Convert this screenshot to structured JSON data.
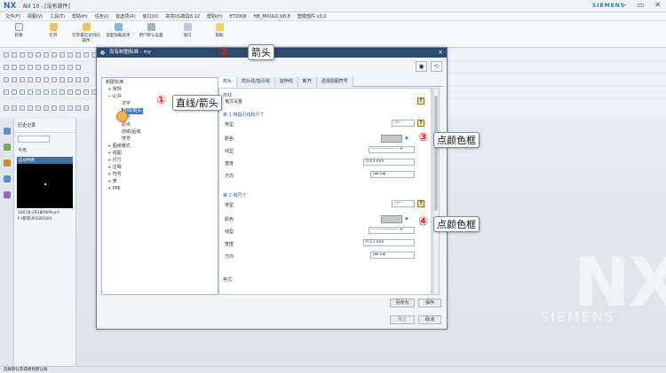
{
  "app": {
    "logo": "NX",
    "title": "NX 10 - [没有部件]",
    "brand": "SIEMENS",
    "window_buttons": [
      "–",
      "▭",
      "✕"
    ]
  },
  "menubar": [
    "文件(F)",
    "视图(V)",
    "工具(T)",
    "帮助(H)",
    "任务(I)",
    "首选项(R)",
    "窗口(O)",
    "高亮UG模具6.12",
    "帮助(H)",
    "ET2008",
    "HB_MOULD V8.8",
    "塑模部件 v3.0"
  ],
  "ribbon": [
    {
      "label": "新建",
      "icon": "new-icon"
    },
    {
      "label": "打开",
      "icon": "open-icon"
    },
    {
      "label": "打开最近访问的部件",
      "icon": "open-recent-icon"
    },
    {
      "label": "装配加载选项",
      "icon": "assembly-load-icon"
    },
    {
      "label": "用户默认设置",
      "icon": "user-defaults-icon"
    },
    {
      "label": "窗口",
      "icon": "window-icon"
    },
    {
      "label": "帮助",
      "icon": "help-icon"
    }
  ],
  "history": {
    "title": "历史记录",
    "today": "今天",
    "thumb_header": "自动判断",
    "file_line1": "18018-20180909.prt",
    "file_line2": "F:\\蔡欣\\X\\18018\\1"
  },
  "watermark": {
    "big": "NX",
    "small": "SIEMENS"
  },
  "status": "选择默认及或者找默认值",
  "dialog": {
    "title": "没有制图标准 - my",
    "tree": {
      "root": "制图标准",
      "items": [
        {
          "label": "常规",
          "level": 1
        },
        {
          "label": "公共",
          "level": 1
        },
        {
          "label": "文字",
          "level": 2
        },
        {
          "label": "直线/箭头",
          "level": 2,
          "selected": true
        },
        {
          "label": "符号",
          "level": 2
        },
        {
          "label": "原点",
          "level": 2
        },
        {
          "label": "前缀/后缀",
          "level": 2
        },
        {
          "label": "符号",
          "level": 2
        },
        {
          "label": "图纸格式",
          "level": 1
        },
        {
          "label": "视图",
          "level": 1
        },
        {
          "label": "尺寸",
          "level": 1
        },
        {
          "label": "注释",
          "level": 1
        },
        {
          "label": "符号",
          "level": 1
        },
        {
          "label": "表",
          "level": 1
        },
        {
          "label": "PMI",
          "level": 1
        }
      ]
    },
    "tabs": [
      "箭头",
      "箭头线/指引线",
      "延伸线",
      "断开",
      "透视视图符号"
    ],
    "form": {
      "top_section": "箭线",
      "top_label": "格式设置",
      "section1": "第 1 侧指引线和尺寸",
      "section2": "第 2 侧尺寸",
      "rows": [
        "类型",
        "颜色",
        "线型",
        "宽度",
        "方向"
      ],
      "type_value": "◁—",
      "width_value": "0.13 mm",
      "color_hint": "◆",
      "direction_value": "|◂x,x◂|",
      "bottom_section": "格式"
    },
    "buttons": {
      "save_as": "另存为",
      "save": "保存",
      "ok": "确定",
      "cancel": "取消"
    }
  },
  "callouts": [
    {
      "num": "①",
      "text": "直线/箭头"
    },
    {
      "num": "②",
      "text": "箭头"
    },
    {
      "num": "③",
      "text": "点颜色框"
    },
    {
      "num": "④",
      "text": "点颜色框"
    }
  ],
  "colors": {
    "accent": "#3a7ac6",
    "dialog_title": "#2a4a6f",
    "swatch": "#c8c8c8",
    "callout_num": "#d8261b"
  }
}
